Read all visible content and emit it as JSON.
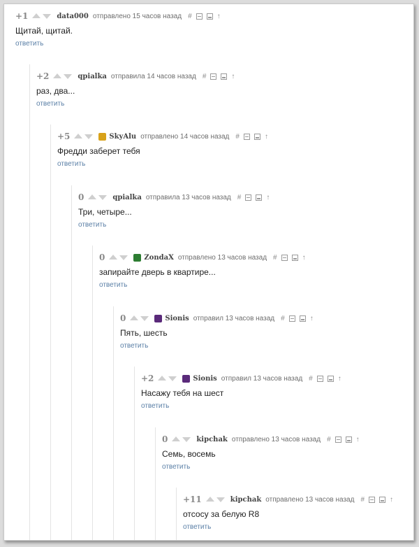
{
  "comments": [
    {
      "score": "+1",
      "user": "data000",
      "ago": "отправлено 15 часов назад",
      "text": "Щитай, щитай.",
      "reply": "ответить",
      "avatar": null
    },
    {
      "score": "+2",
      "user": "qpialka",
      "ago": "отправила 14 часов назад",
      "text": "раз, два...",
      "reply": "ответить",
      "avatar": null
    },
    {
      "score": "+5",
      "user": "SkyAlu",
      "ago": "отправлено 14 часов назад",
      "text": "Фредди заберет тебя",
      "reply": "ответить",
      "avatar": "#d8a21a"
    },
    {
      "score": "0",
      "user": "qpialka",
      "ago": "отправила 13 часов назад",
      "text": "Три, четыре...",
      "reply": "ответить",
      "avatar": null
    },
    {
      "score": "0",
      "user": "ZondaX",
      "ago": "отправлено 13 часов назад",
      "text": "запирайте дверь в квартире...",
      "reply": "ответить",
      "avatar": "#2d7d32"
    },
    {
      "score": "0",
      "user": "Sionis",
      "ago": "отправил 13 часов назад",
      "text": "Пять, шесть",
      "reply": "ответить",
      "avatar": "#5a2a7a"
    },
    {
      "score": "+2",
      "user": "Sionis",
      "ago": "отправил 13 часов назад",
      "text": "Насажу тебя на шест",
      "reply": "ответить",
      "avatar": "#5a2a7a"
    },
    {
      "score": "0",
      "user": "kipchak",
      "ago": "отправлено 13 часов назад",
      "text": "Семь, восемь",
      "reply": "ответить",
      "avatar": null
    },
    {
      "score": "+11",
      "user": "kipchak",
      "ago": "отправлено 13 часов назад",
      "text": "отсосу за белую R8",
      "reply": "ответить",
      "avatar": null
    }
  ],
  "icons": {
    "permalink": "#",
    "collapse": "collapse-icon",
    "save": "save-icon",
    "parent": "↑"
  }
}
